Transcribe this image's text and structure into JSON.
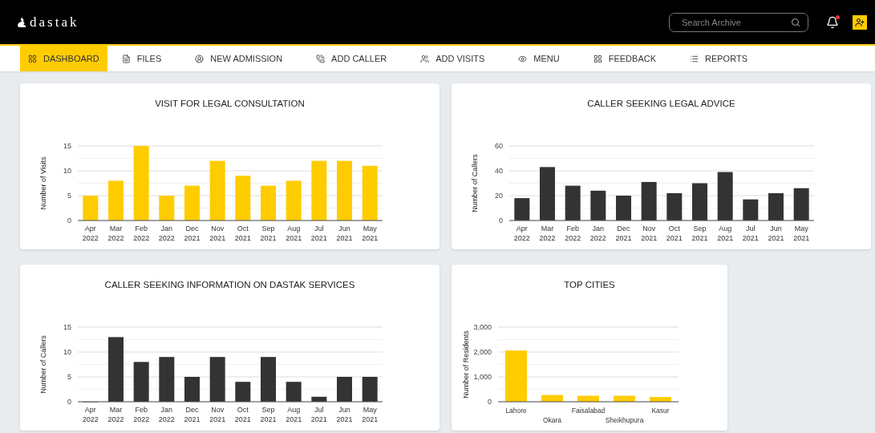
{
  "header": {
    "logo": "dastak",
    "search": {
      "placeholder": "Search Archive"
    },
    "notification_dot": true
  },
  "nav": [
    {
      "label": "DASHBOARD",
      "selected": true
    },
    {
      "label": "FILES",
      "selected": false
    },
    {
      "label": "NEW ADMISSION",
      "selected": false
    },
    {
      "label": "ADD CALLER",
      "selected": false
    },
    {
      "label": "ADD VISITS",
      "selected": false
    },
    {
      "label": "MENU",
      "selected": false
    },
    {
      "label": "FEEDBACK",
      "selected": false
    },
    {
      "label": "REPORTS",
      "selected": false
    }
  ],
  "cards": [
    {
      "title": "VISIT FOR LEGAL CONSULTATION",
      "chart_data": {
        "type": "bar",
        "ylabel": "Number of Visits",
        "categories": [
          "Apr 2022",
          "Mar 2022",
          "Feb 2022",
          "Jan 2022",
          "Dec 2021",
          "Nov 2021",
          "Oct 2021",
          "Sep 2021",
          "Aug 2021",
          "Jul 2021",
          "Jun 2021",
          "May 2021"
        ],
        "series": [
          {
            "color": "#ffcc00",
            "values": [
              5,
              8,
              15,
              5,
              7,
              12,
              9,
              7,
              8,
              12,
              12,
              11
            ]
          }
        ],
        "ylim": [
          0,
          15
        ],
        "yticks": [
          0,
          5,
          10,
          15
        ]
      }
    },
    {
      "title": "CALLER SEEKING LEGAL ADVICE",
      "chart_data": {
        "type": "bar",
        "ylabel": "Number of Callers",
        "categories": [
          "Apr 2022",
          "Mar 2022",
          "Feb 2022",
          "Jan 2022",
          "Dec 2021",
          "Nov 2021",
          "Oct 2021",
          "Sep 2021",
          "Aug 2021",
          "Jul 2021",
          "Jun 2021",
          "May 2021"
        ],
        "series": [
          {
            "color": "#333333",
            "values": [
              18,
              43,
              28,
              24,
              20,
              31,
              22,
              30,
              39,
              17,
              22,
              26
            ]
          }
        ],
        "ylim": [
          0,
          60
        ],
        "yticks": [
          0,
          20,
          40,
          60
        ]
      }
    },
    {
      "title": "CALLER SEEKING INFORMATION ON DASTAK SERVICES",
      "chart_data": {
        "type": "bar",
        "ylabel": "Number of Callers",
        "categories": [
          "Apr 2022",
          "Mar 2022",
          "Feb 2022",
          "Jan 2022",
          "Dec 2021",
          "Nov 2021",
          "Oct 2021",
          "Sep 2021",
          "Aug 2021",
          "Jul 2021",
          "Jun 2021",
          "May 2021"
        ],
        "series": [
          {
            "color": "#333333",
            "values": [
              0,
              13,
              8,
              9,
              5,
              9,
              4,
              9,
              4,
              1,
              5,
              5
            ]
          }
        ],
        "ylim": [
          0,
          15
        ],
        "yticks": [
          0,
          5,
          10,
          15
        ]
      }
    },
    {
      "title": "TOP CITIES",
      "chart_data": {
        "type": "bar",
        "ylabel": "Number of Residents",
        "categories": [
          "Lahore",
          "Okara",
          "Faisalabad",
          "Sheikhupura",
          "Kasur"
        ],
        "series": [
          {
            "color": "#ffcc00",
            "values": [
              2060,
              270,
              240,
              240,
              190
            ]
          }
        ],
        "ylim": [
          0,
          3000
        ],
        "yticks": [
          {
            "value": 0,
            "label": "0"
          },
          {
            "value": 1000,
            "label": "1,000"
          },
          {
            "value": 2000,
            "label": "2,000"
          },
          {
            "value": 3000,
            "label": "3,000"
          }
        ]
      }
    }
  ]
}
